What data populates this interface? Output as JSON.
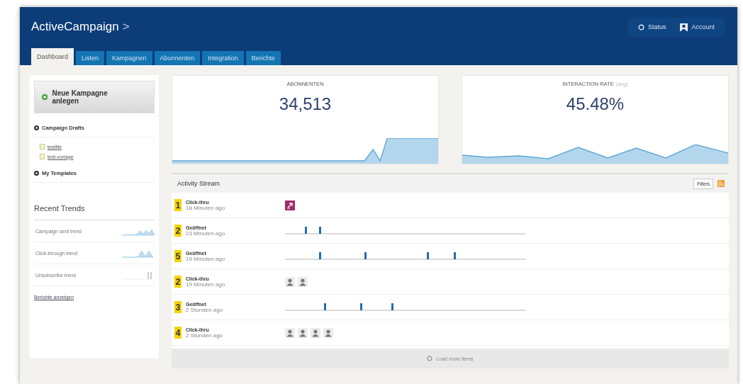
{
  "header": {
    "logo": "ActiveCampaign",
    "logo_mark": ">",
    "actions": [
      {
        "label": "Status",
        "kind": "status"
      },
      {
        "label": "Account",
        "kind": "account"
      }
    ]
  },
  "tabs": [
    {
      "label": "Dashboard",
      "selected": true
    },
    {
      "label": "Listen",
      "selected": false
    },
    {
      "label": "Kampagnen",
      "selected": false
    },
    {
      "label": "Abonnenten",
      "selected": false
    },
    {
      "label": "Integration",
      "selected": false
    },
    {
      "label": "Berichte",
      "selected": false
    }
  ],
  "sidebar": {
    "new_campaign": "Neue Kampagne anlegen",
    "sections": [
      {
        "title": "Campaign Drafts",
        "items": [
          "testfile",
          "test-vorlage"
        ]
      },
      {
        "title": "My Templates"
      }
    ],
    "trends_title": "Recent Trends",
    "trends": [
      {
        "label": "Campaign sent trend",
        "kind": "area"
      },
      {
        "label": "Click-through trend",
        "kind": "peaks"
      },
      {
        "label": "Unsubscribe trend",
        "kind": "bars"
      }
    ],
    "reports_link": "Berichte anzeigen"
  },
  "stats": [
    {
      "title": "ABONNENTEN",
      "value": "34,513",
      "kind": "step"
    },
    {
      "title": "INTERACTION RATE",
      "note": "(avg)",
      "value": "45.48%",
      "kind": "zigzag"
    }
  ],
  "activity": {
    "title": "Activity Stream",
    "filter_button": "Filters",
    "rows": [
      {
        "count": "1",
        "action": "Click-thru",
        "time": "18 Minuten ago",
        "kind": "message"
      },
      {
        "count": "2",
        "action": "Geöffnet",
        "time": "23 Minuten ago",
        "kind": "timeline"
      },
      {
        "count": "5",
        "action": "Geöffnet",
        "time": "19 Minuten ago",
        "kind": "timeline"
      },
      {
        "count": "2",
        "action": "Click-thru",
        "time": "19 Minuten ago",
        "kind": "contacts"
      },
      {
        "count": "3",
        "action": "Geöffnet",
        "time": "2 Stunden ago",
        "kind": "timeline"
      },
      {
        "count": "4",
        "action": "Click-thru",
        "time": "2 Stunden ago",
        "kind": "contacts"
      }
    ],
    "load_more": "Load more items"
  }
}
